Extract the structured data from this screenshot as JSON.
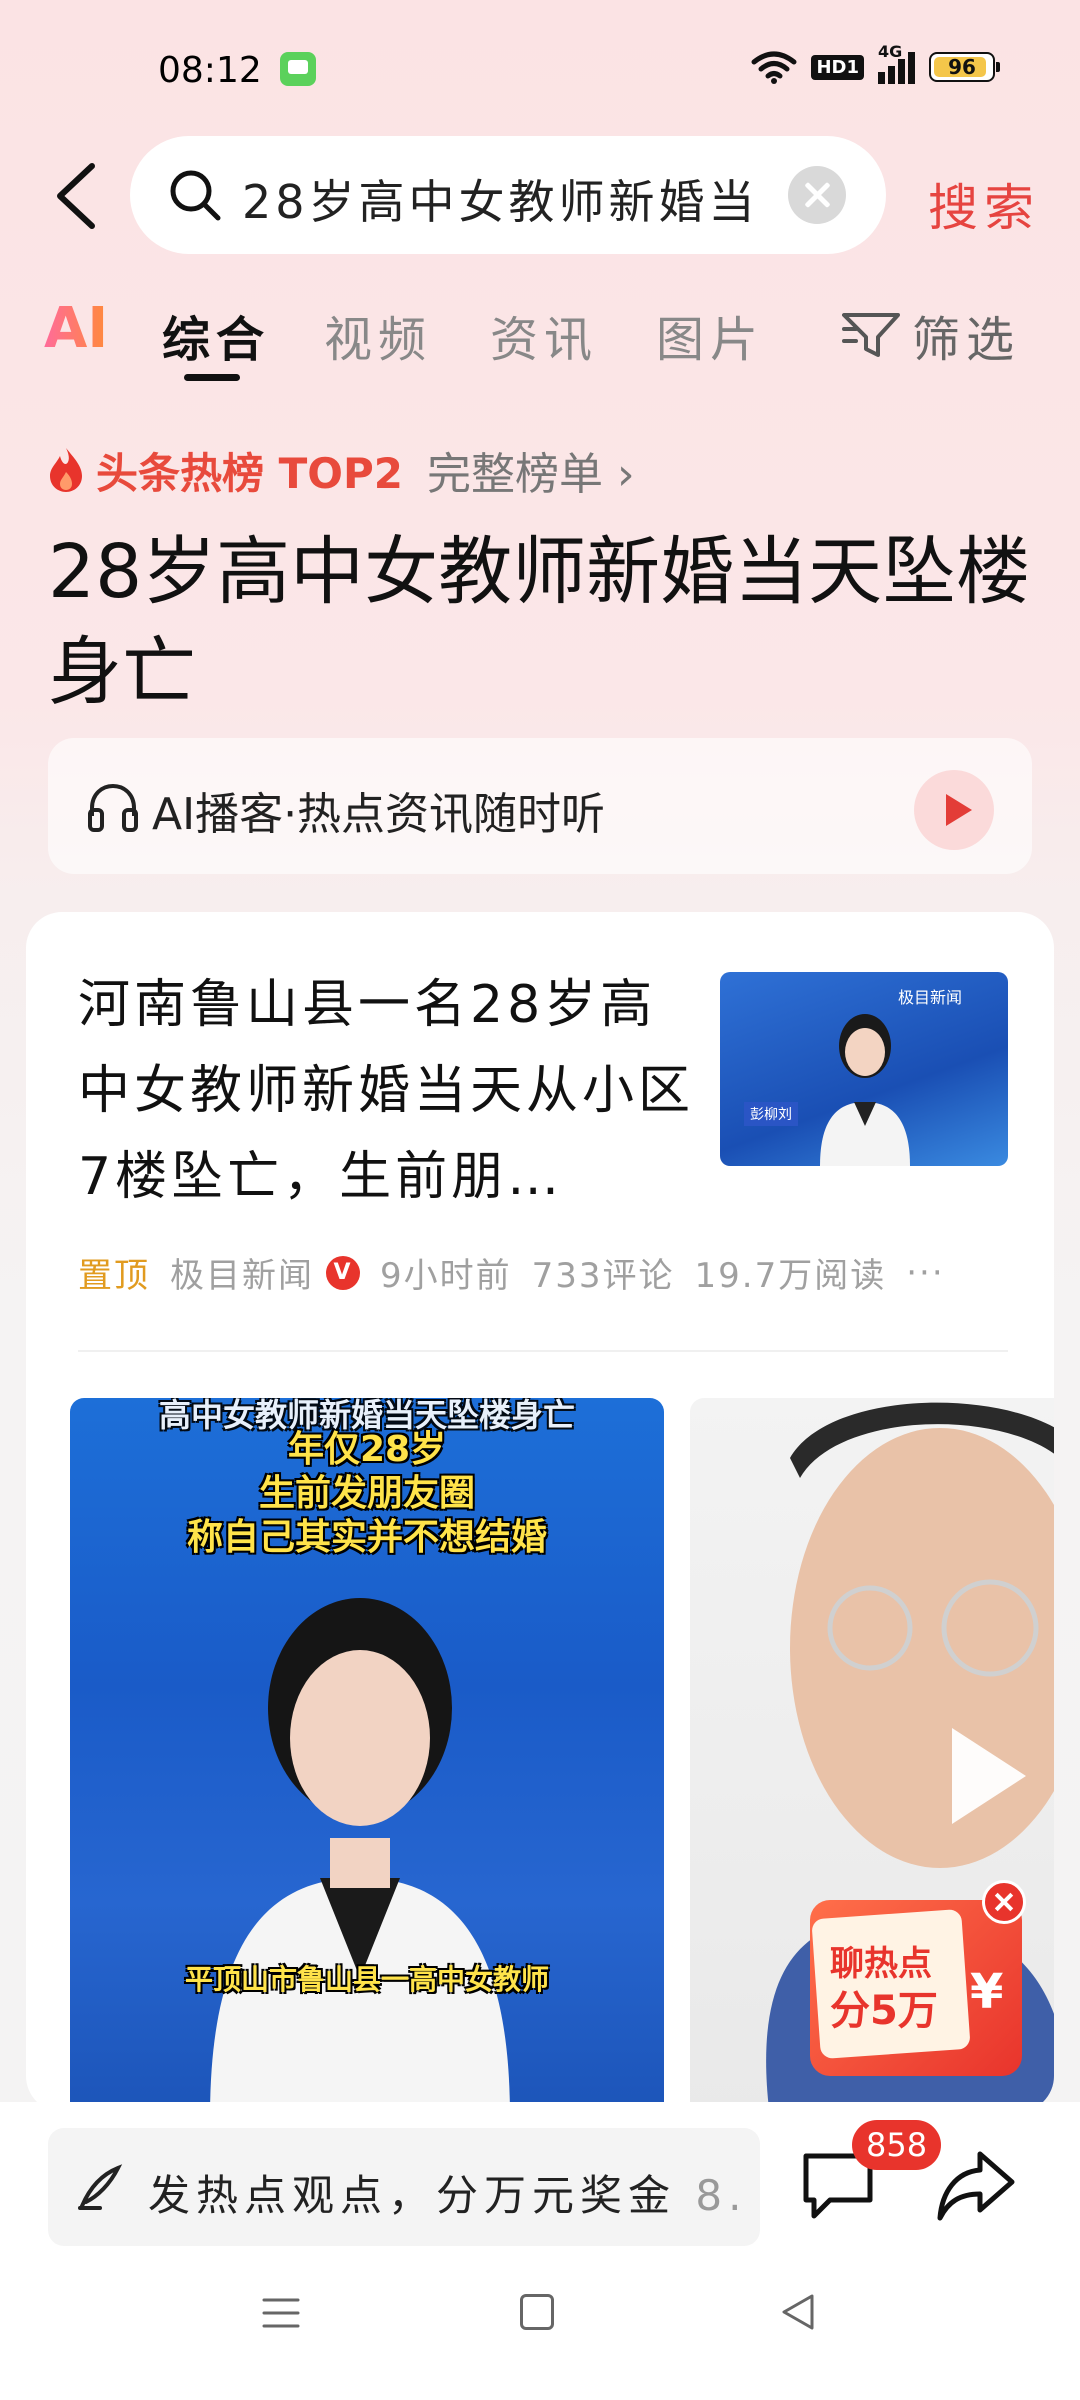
{
  "status_bar": {
    "time": "08:12",
    "hd": "HD1",
    "network": "4G",
    "battery": "96"
  },
  "search": {
    "query": "28岁高中女教师新婚当",
    "submit_label": "搜索"
  },
  "tabs": {
    "ai_label": "AI",
    "items": [
      {
        "label": "综合"
      },
      {
        "label": "视频"
      },
      {
        "label": "资讯"
      },
      {
        "label": "图片"
      }
    ],
    "filter_label": "筛选"
  },
  "hot": {
    "label": "头条热榜 TOP2",
    "full_list": "完整榜单 ›",
    "headline": "28岁高中女教师新婚当天坠楼身亡"
  },
  "podcast": {
    "text": "AI播客·热点资讯随时听"
  },
  "article": {
    "title": "河南鲁山县一名28岁高中女教师新婚当天从小区7楼坠亡，生前朋…",
    "pin": "置顶",
    "source": "极目新闻",
    "verified": "V",
    "time": "9小时前",
    "comments": "733评论",
    "reads": "19.7万阅读",
    "more": "···",
    "thumb_logo": "极目新闻",
    "thumb_name": "彭柳刘"
  },
  "video1": {
    "caption_top": "高中女教师新婚当天坠楼身亡",
    "caption_1": "年仅28岁",
    "caption_2": "生前发朋友圈",
    "caption_3": "称自己其实并不想结婚",
    "subtitle": "平顶山市鲁山县一高中女教师"
  },
  "promo": {
    "line1": "聊热点",
    "line2": "分5万",
    "yen": "¥"
  },
  "bottom": {
    "comment_placeholder": "发热点观点，分万元奖金",
    "comment_suffix": "8.",
    "comment_count": "858"
  }
}
